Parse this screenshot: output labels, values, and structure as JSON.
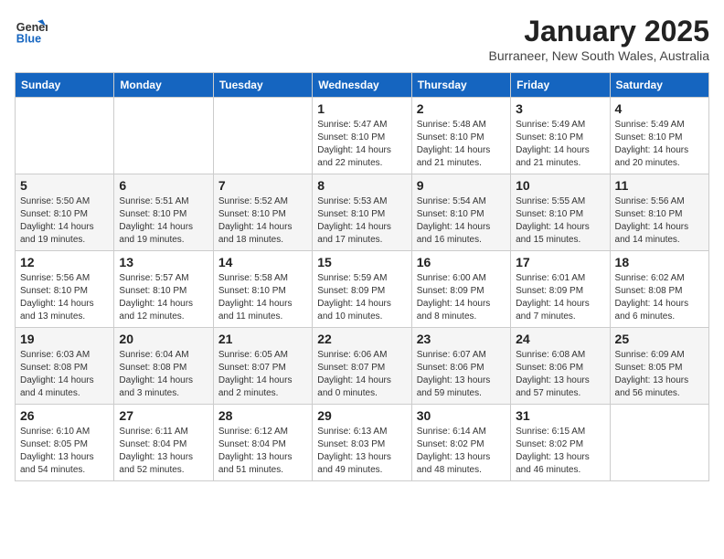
{
  "header": {
    "logo_line1": "General",
    "logo_line2": "Blue",
    "month": "January 2025",
    "location": "Burraneer, New South Wales, Australia"
  },
  "weekdays": [
    "Sunday",
    "Monday",
    "Tuesday",
    "Wednesday",
    "Thursday",
    "Friday",
    "Saturday"
  ],
  "weeks": [
    [
      {
        "day": "",
        "info": ""
      },
      {
        "day": "",
        "info": ""
      },
      {
        "day": "",
        "info": ""
      },
      {
        "day": "1",
        "info": "Sunrise: 5:47 AM\nSunset: 8:10 PM\nDaylight: 14 hours\nand 22 minutes."
      },
      {
        "day": "2",
        "info": "Sunrise: 5:48 AM\nSunset: 8:10 PM\nDaylight: 14 hours\nand 21 minutes."
      },
      {
        "day": "3",
        "info": "Sunrise: 5:49 AM\nSunset: 8:10 PM\nDaylight: 14 hours\nand 21 minutes."
      },
      {
        "day": "4",
        "info": "Sunrise: 5:49 AM\nSunset: 8:10 PM\nDaylight: 14 hours\nand 20 minutes."
      }
    ],
    [
      {
        "day": "5",
        "info": "Sunrise: 5:50 AM\nSunset: 8:10 PM\nDaylight: 14 hours\nand 19 minutes."
      },
      {
        "day": "6",
        "info": "Sunrise: 5:51 AM\nSunset: 8:10 PM\nDaylight: 14 hours\nand 19 minutes."
      },
      {
        "day": "7",
        "info": "Sunrise: 5:52 AM\nSunset: 8:10 PM\nDaylight: 14 hours\nand 18 minutes."
      },
      {
        "day": "8",
        "info": "Sunrise: 5:53 AM\nSunset: 8:10 PM\nDaylight: 14 hours\nand 17 minutes."
      },
      {
        "day": "9",
        "info": "Sunrise: 5:54 AM\nSunset: 8:10 PM\nDaylight: 14 hours\nand 16 minutes."
      },
      {
        "day": "10",
        "info": "Sunrise: 5:55 AM\nSunset: 8:10 PM\nDaylight: 14 hours\nand 15 minutes."
      },
      {
        "day": "11",
        "info": "Sunrise: 5:56 AM\nSunset: 8:10 PM\nDaylight: 14 hours\nand 14 minutes."
      }
    ],
    [
      {
        "day": "12",
        "info": "Sunrise: 5:56 AM\nSunset: 8:10 PM\nDaylight: 14 hours\nand 13 minutes."
      },
      {
        "day": "13",
        "info": "Sunrise: 5:57 AM\nSunset: 8:10 PM\nDaylight: 14 hours\nand 12 minutes."
      },
      {
        "day": "14",
        "info": "Sunrise: 5:58 AM\nSunset: 8:10 PM\nDaylight: 14 hours\nand 11 minutes."
      },
      {
        "day": "15",
        "info": "Sunrise: 5:59 AM\nSunset: 8:09 PM\nDaylight: 14 hours\nand 10 minutes."
      },
      {
        "day": "16",
        "info": "Sunrise: 6:00 AM\nSunset: 8:09 PM\nDaylight: 14 hours\nand 8 minutes."
      },
      {
        "day": "17",
        "info": "Sunrise: 6:01 AM\nSunset: 8:09 PM\nDaylight: 14 hours\nand 7 minutes."
      },
      {
        "day": "18",
        "info": "Sunrise: 6:02 AM\nSunset: 8:08 PM\nDaylight: 14 hours\nand 6 minutes."
      }
    ],
    [
      {
        "day": "19",
        "info": "Sunrise: 6:03 AM\nSunset: 8:08 PM\nDaylight: 14 hours\nand 4 minutes."
      },
      {
        "day": "20",
        "info": "Sunrise: 6:04 AM\nSunset: 8:08 PM\nDaylight: 14 hours\nand 3 minutes."
      },
      {
        "day": "21",
        "info": "Sunrise: 6:05 AM\nSunset: 8:07 PM\nDaylight: 14 hours\nand 2 minutes."
      },
      {
        "day": "22",
        "info": "Sunrise: 6:06 AM\nSunset: 8:07 PM\nDaylight: 14 hours\nand 0 minutes."
      },
      {
        "day": "23",
        "info": "Sunrise: 6:07 AM\nSunset: 8:06 PM\nDaylight: 13 hours\nand 59 minutes."
      },
      {
        "day": "24",
        "info": "Sunrise: 6:08 AM\nSunset: 8:06 PM\nDaylight: 13 hours\nand 57 minutes."
      },
      {
        "day": "25",
        "info": "Sunrise: 6:09 AM\nSunset: 8:05 PM\nDaylight: 13 hours\nand 56 minutes."
      }
    ],
    [
      {
        "day": "26",
        "info": "Sunrise: 6:10 AM\nSunset: 8:05 PM\nDaylight: 13 hours\nand 54 minutes."
      },
      {
        "day": "27",
        "info": "Sunrise: 6:11 AM\nSunset: 8:04 PM\nDaylight: 13 hours\nand 52 minutes."
      },
      {
        "day": "28",
        "info": "Sunrise: 6:12 AM\nSunset: 8:04 PM\nDaylight: 13 hours\nand 51 minutes."
      },
      {
        "day": "29",
        "info": "Sunrise: 6:13 AM\nSunset: 8:03 PM\nDaylight: 13 hours\nand 49 minutes."
      },
      {
        "day": "30",
        "info": "Sunrise: 6:14 AM\nSunset: 8:02 PM\nDaylight: 13 hours\nand 48 minutes."
      },
      {
        "day": "31",
        "info": "Sunrise: 6:15 AM\nSunset: 8:02 PM\nDaylight: 13 hours\nand 46 minutes."
      },
      {
        "day": "",
        "info": ""
      }
    ]
  ]
}
